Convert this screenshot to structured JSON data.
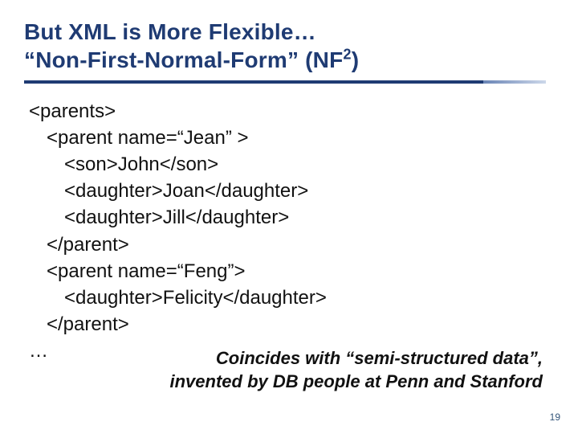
{
  "title": {
    "line1": "But XML is More Flexible…",
    "line2_prefix": "“Non-First-Normal-Form” (NF",
    "line2_super": "2",
    "line2_suffix": ")"
  },
  "code": {
    "l1": "<parents>",
    "l2": "<parent name=“Jean” >",
    "l3": "<son>John</son>",
    "l4": "<daughter>Joan</daughter>",
    "l5": "<daughter>Jill</daughter>",
    "l6": "</parent>",
    "l7": "<parent name=“Feng”>",
    "l8": "<daughter>Felicity</daughter>",
    "l9": "</parent>",
    "l10": "…"
  },
  "caption": {
    "line1": "Coincides with “semi-structured data”,",
    "line2": "invented by DB people at Penn and Stanford"
  },
  "pagenum": "19"
}
